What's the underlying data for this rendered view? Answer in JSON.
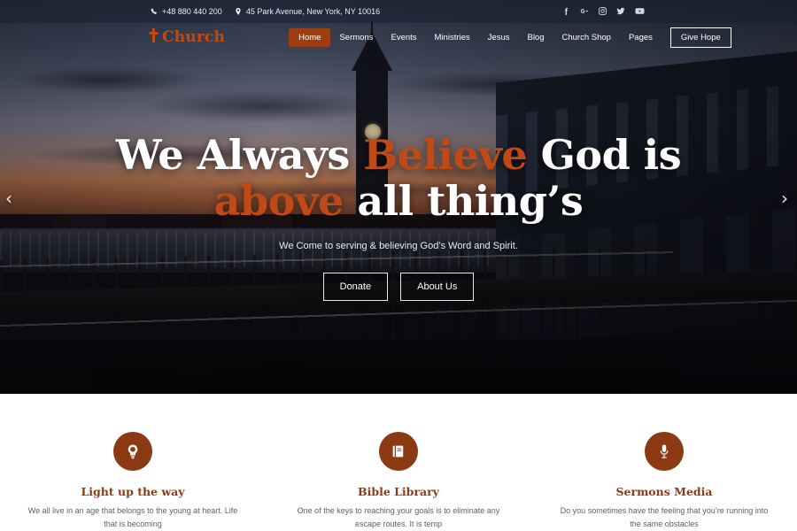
{
  "topbar": {
    "phone": "+48 880 440 200",
    "address": "45 Park Avenue, New York, NY 10016",
    "phone_icon": "phone-icon",
    "location_icon": "map-pin-icon",
    "social": [
      {
        "name": "facebook-icon",
        "label": "Facebook"
      },
      {
        "name": "google-plus-icon",
        "label": "Google Plus"
      },
      {
        "name": "instagram-icon",
        "label": "Instagram"
      },
      {
        "name": "twitter-icon",
        "label": "Twitter"
      },
      {
        "name": "youtube-icon",
        "label": "YouTube"
      }
    ]
  },
  "brand": {
    "name": "Church",
    "icon": "cross-icon",
    "color": "#c04a16"
  },
  "nav": {
    "items": [
      {
        "label": "Home",
        "active": true
      },
      {
        "label": "Sermons",
        "active": false
      },
      {
        "label": "Events",
        "active": false
      },
      {
        "label": "Ministries",
        "active": false
      },
      {
        "label": "Jesus",
        "active": false
      },
      {
        "label": "Blog",
        "active": false
      },
      {
        "label": "Church Shop",
        "active": false
      },
      {
        "label": "Pages",
        "active": false
      }
    ],
    "cta_label": "Give Hope",
    "active_bg": "#9e3d11"
  },
  "hero": {
    "title_part1": "We Always ",
    "title_highlight1": "Believe",
    "title_part2": " God is",
    "title_highlight2": "above",
    "title_part3": " all thing’s",
    "subtitle": "We Come to serving & believing God’s Word and Spirit.",
    "button_primary": "Donate",
    "button_secondary": "About Us",
    "prev_arrow": "‹",
    "next_arrow": "›",
    "highlight_color": "#bf4a17"
  },
  "features": {
    "accent_color": "#8c3a14",
    "items": [
      {
        "icon": "lightbulb-icon",
        "title": "Light up the way",
        "text": "We all live in an age that belongs to the young at heart. Life that is becoming"
      },
      {
        "icon": "book-icon",
        "title": "Bible Library",
        "text": "One of the keys to reaching your goals is to eliminate any escape routes. It is temp"
      },
      {
        "icon": "microphone-icon",
        "title": "Sermons Media",
        "text": "Do you sometimes have the feeling that you’re running into the same obstacles"
      }
    ]
  }
}
